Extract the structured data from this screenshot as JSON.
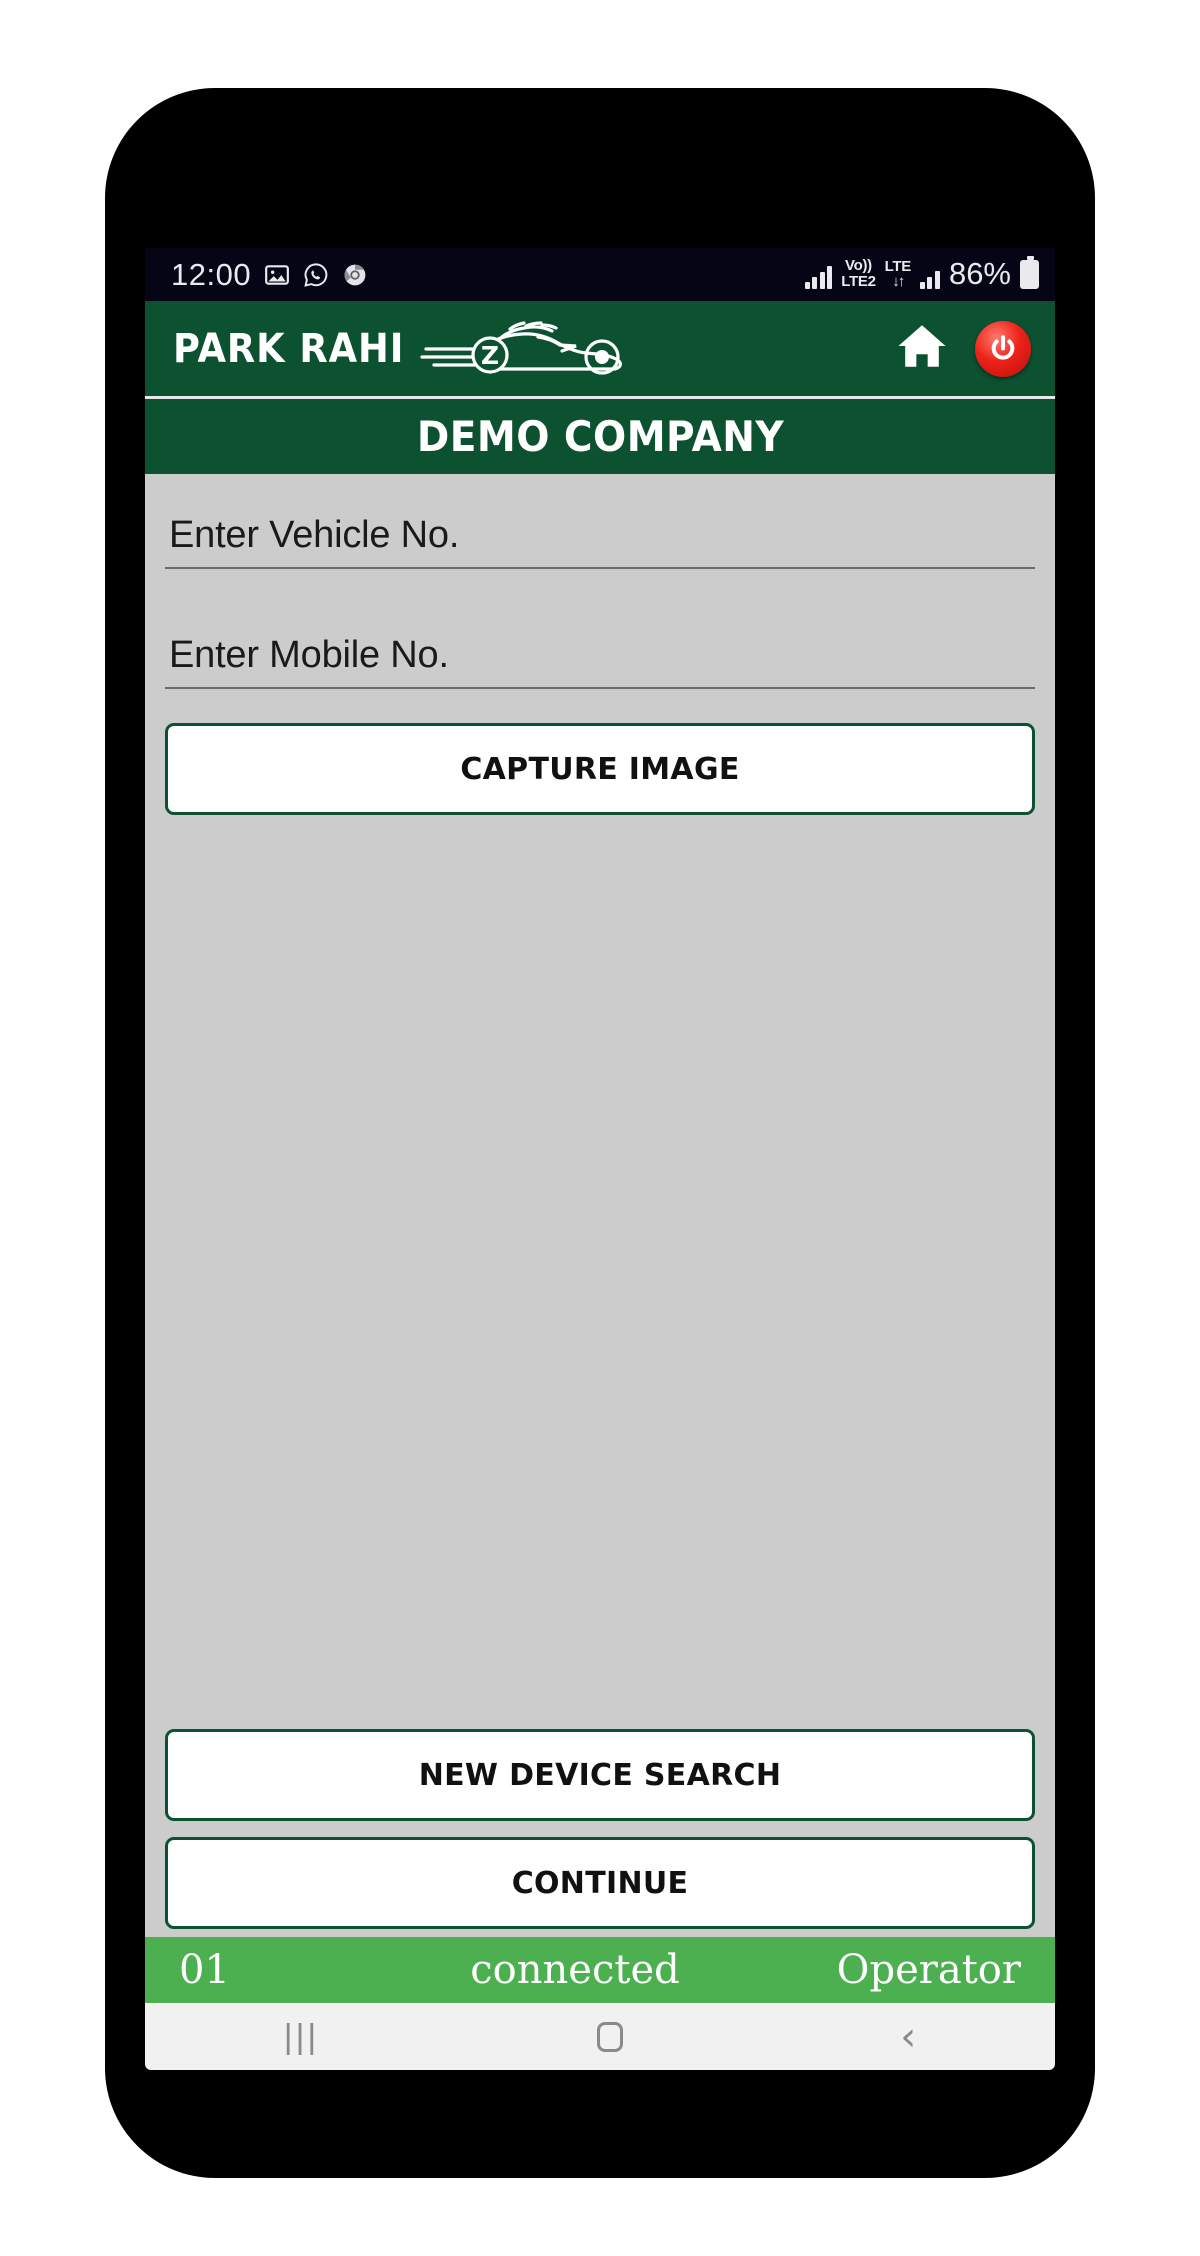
{
  "status_bar": {
    "time": "12:00",
    "left_icons": [
      "image-icon",
      "whatsapp-icon",
      "chrome-icon"
    ],
    "volte_label": "Vo))",
    "sim_label": "LTE2",
    "network_label": "LTE",
    "data_arrows": "↓↑",
    "battery_percent": "86%",
    "battery_icon": "battery-icon"
  },
  "header": {
    "brand_name": "PARK RAHI",
    "brand_mark": "race-car-icon",
    "home_icon": "home-icon",
    "power_icon": "power-icon"
  },
  "company_bar": {
    "title": "DEMO COMPANY"
  },
  "form": {
    "vehicle_field": {
      "label": "Enter Vehicle No.",
      "value": "",
      "placeholder": "Enter Vehicle No."
    },
    "mobile_field": {
      "label": "Enter Mobile No.",
      "value": "",
      "placeholder": "Enter Mobile No."
    },
    "capture_button": "CAPTURE IMAGE",
    "device_search_button": "NEW DEVICE SEARCH",
    "continue_button": "CONTINUE"
  },
  "app_footer": {
    "slot": "01",
    "connection_status": "connected",
    "role": "Operator"
  },
  "nav_bar": {
    "recents_icon": "|||",
    "home_icon": "home-square-icon",
    "back_icon": "‹"
  },
  "colors": {
    "brand_green": "#0c5231",
    "status_green": "#4caf50",
    "screen_background": "#cccccc",
    "power_red": "#ee2219"
  }
}
